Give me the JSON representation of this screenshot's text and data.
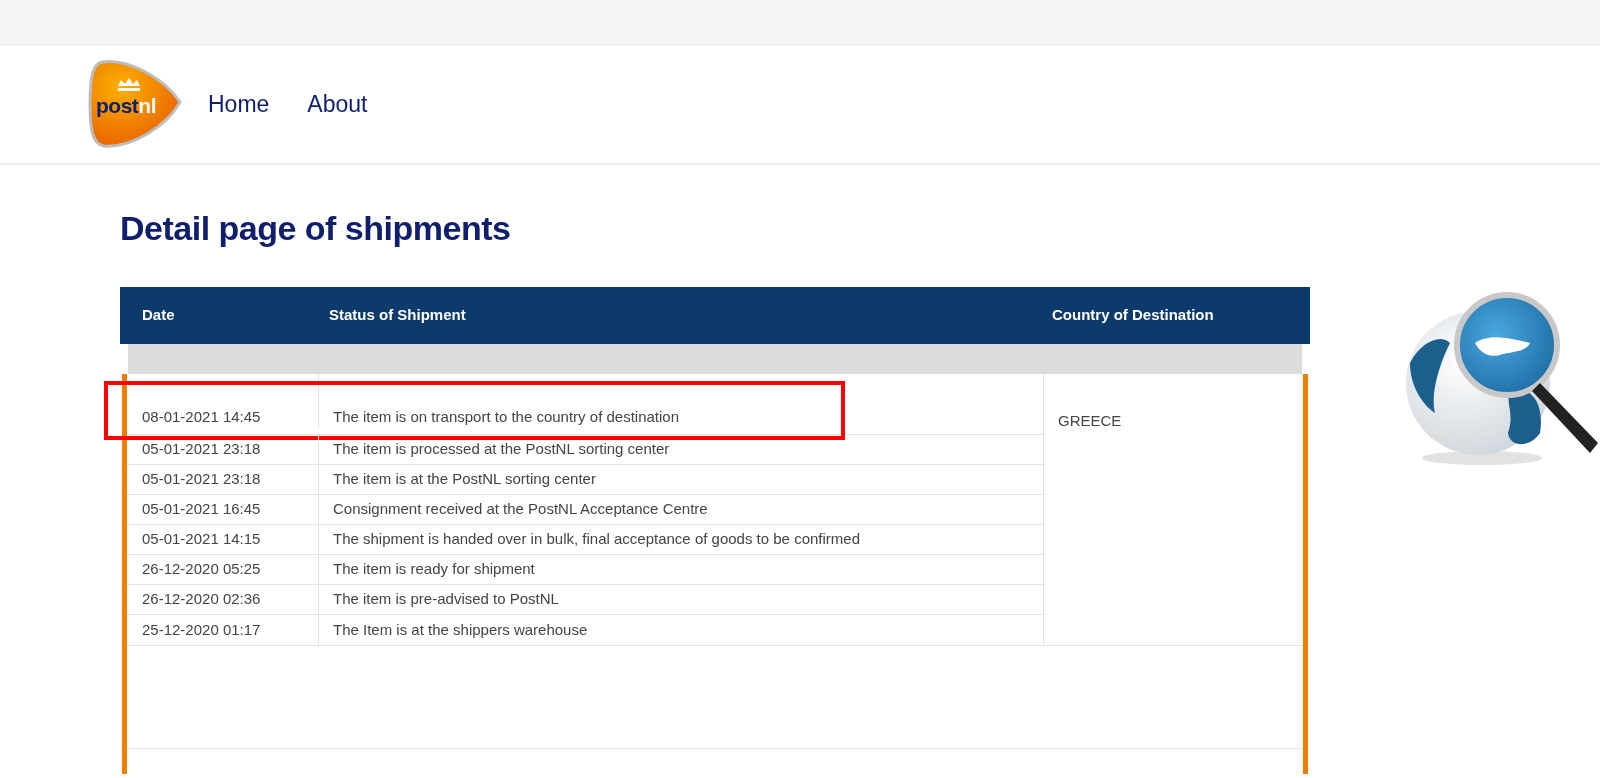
{
  "logo": [
    "post",
    "nl"
  ],
  "nav": {
    "links": [
      "Home",
      "About"
    ]
  },
  "title": "Detail page of shipments",
  "table": {
    "columns": [
      "Date",
      "Status of Shipment",
      "Country of Destination"
    ],
    "country": "GREECE",
    "rows": [
      {
        "date": "08-01-2021 14:45",
        "status": "The item is on transport to the country of destination",
        "highlighted": true
      },
      {
        "date": "05-01-2021 23:18",
        "status": "The item is processed at the PostNL sorting center",
        "highlighted": false
      },
      {
        "date": "05-01-2021 23:18",
        "status": "The item is at the PostNL sorting center",
        "highlighted": false
      },
      {
        "date": "05-01-2021 16:45",
        "status": "Consignment received at the PostNL Acceptance Centre",
        "highlighted": false
      },
      {
        "date": "05-01-2021 14:15",
        "status": "The shipment is handed over in bulk, final acceptance of goods to be confirmed",
        "highlighted": false
      },
      {
        "date": "26-12-2020 05:25",
        "status": "The item is ready for shipment",
        "highlighted": false
      },
      {
        "date": "26-12-2020 02:36",
        "status": "The item is pre-advised to PostNL",
        "highlighted": false
      },
      {
        "date": "25-12-2020 01:17",
        "status": "The Item is at the shippers warehouse",
        "highlighted": false
      }
    ]
  }
}
